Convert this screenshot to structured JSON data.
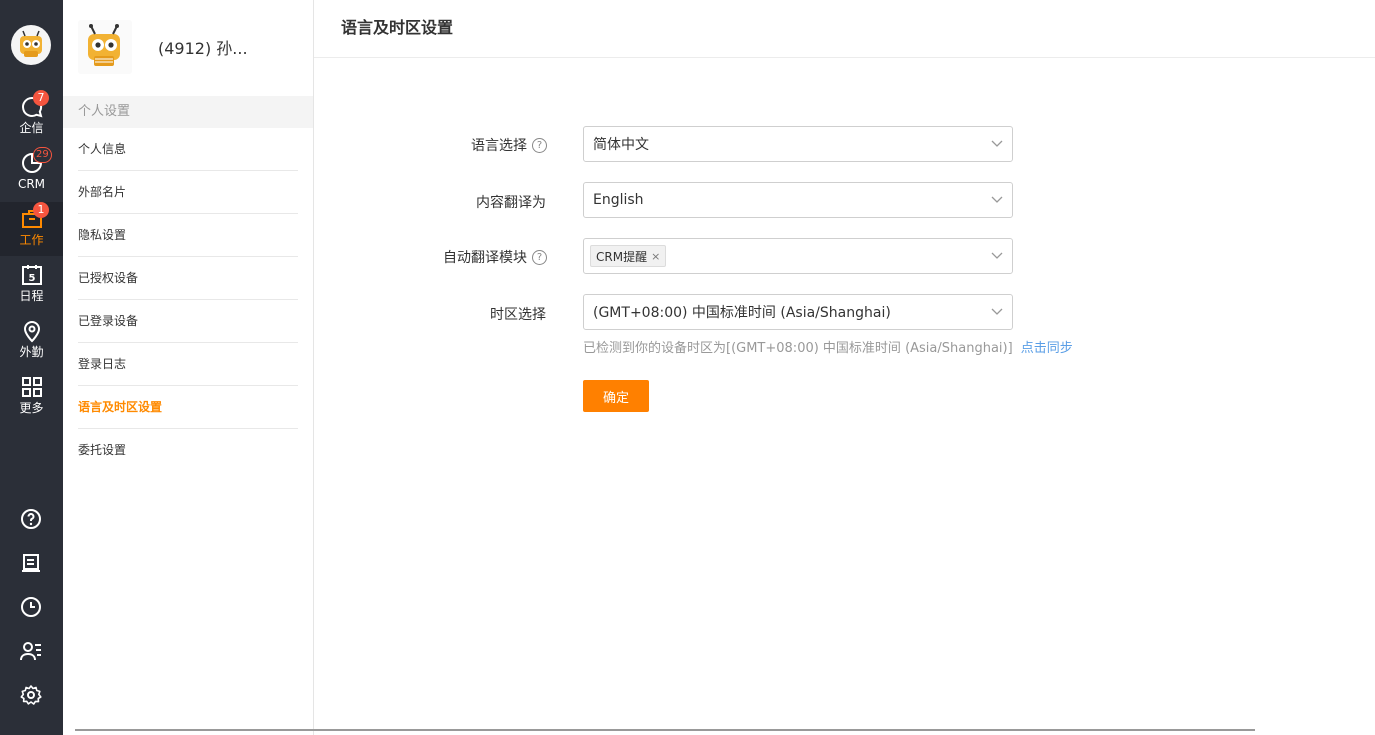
{
  "rail": {
    "items": [
      {
        "label": "企信",
        "badge": "7",
        "icon": "chat-bubble-icon"
      },
      {
        "label": "CRM",
        "badge": "29",
        "icon": "pie-chart-icon"
      },
      {
        "label": "工作",
        "badge": "1",
        "icon": "briefcase-icon"
      },
      {
        "label": "日程",
        "badge": "",
        "icon": "calendar-icon",
        "day": "5"
      },
      {
        "label": "外勤",
        "badge": "",
        "icon": "location-pin-icon"
      },
      {
        "label": "更多",
        "badge": "",
        "icon": "grid-icon"
      }
    ],
    "bottom_icons": [
      "help-icon",
      "notes-icon",
      "clock-icon",
      "contacts-icon",
      "settings-icon"
    ]
  },
  "profile": {
    "name": "(4912)  孙..."
  },
  "side": {
    "section_title": "个人设置",
    "menu": [
      {
        "label": "个人信息",
        "active": false
      },
      {
        "label": "外部名片",
        "active": false
      },
      {
        "label": "隐私设置",
        "active": false
      },
      {
        "label": "已授权设备",
        "active": false
      },
      {
        "label": "已登录设备",
        "active": false
      },
      {
        "label": "登录日志",
        "active": false
      },
      {
        "label": "语言及时区设置",
        "active": true
      },
      {
        "label": "委托设置",
        "active": false
      }
    ]
  },
  "main": {
    "title": "语言及时区设置",
    "fields": {
      "language": {
        "label": "语言选择",
        "value": "简体中文"
      },
      "translate_to": {
        "label": "内容翻译为",
        "value": "English"
      },
      "auto_translate": {
        "label": "自动翻译模块",
        "tag": "CRM提醒"
      },
      "timezone": {
        "label": "时区选择",
        "value": "(GMT+08:00) 中国标准时间 (Asia/Shanghai)"
      }
    },
    "hint": "已检测到你的设备时区为[(GMT+08:00) 中国标准时间 (Asia/Shanghai)]",
    "sync_link": "点击同步",
    "confirm_button": "确定"
  },
  "colors": {
    "accent": "#ff8000",
    "rail_bg": "#2b2f38",
    "badge": "#f5553f",
    "link": "#5a9ee6"
  }
}
